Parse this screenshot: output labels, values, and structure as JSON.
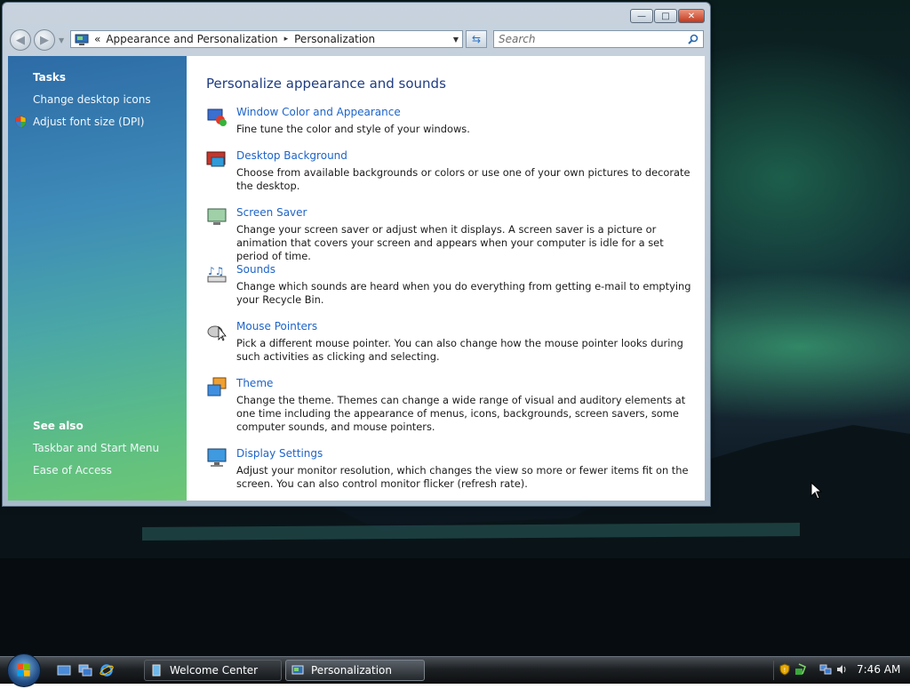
{
  "window": {
    "controls": {
      "minimize": "—",
      "maximize": "□",
      "close": "✕"
    }
  },
  "address_bar": {
    "chevron": "«",
    "breadcrumbs": [
      "Appearance and Personalization",
      "Personalization"
    ],
    "separator": "▸"
  },
  "search": {
    "placeholder": "Search"
  },
  "sidebar": {
    "tasks_heading": "Tasks",
    "tasks": [
      "Change desktop icons",
      "Adjust font size (DPI)"
    ],
    "see_also_heading": "See also",
    "see_also": [
      "Taskbar and Start Menu",
      "Ease of Access"
    ]
  },
  "main": {
    "heading": "Personalize appearance and sounds",
    "items": [
      {
        "title": "Window Color and Appearance",
        "description": "Fine tune the color and style of your windows.",
        "icon": "window-color-icon"
      },
      {
        "title": "Desktop Background",
        "description": "Choose from available backgrounds or colors or use one of your own pictures to decorate the desktop.",
        "icon": "desktop-background-icon"
      },
      {
        "title": "Screen Saver",
        "description": "Change your screen saver or adjust when it displays. A screen saver is a picture or animation that covers your screen and appears when your computer is idle for a set period of time.",
        "icon": "screen-saver-icon"
      },
      {
        "title": "Sounds",
        "description": "Change which sounds are heard when you do everything from getting e-mail to emptying your Recycle Bin.",
        "icon": "sounds-icon"
      },
      {
        "title": "Mouse Pointers",
        "description": "Pick a different mouse pointer. You can also change how the mouse pointer looks during such activities as clicking and selecting.",
        "icon": "mouse-pointers-icon"
      },
      {
        "title": "Theme",
        "description": "Change the theme. Themes can change a wide range of visual and auditory elements at one time including the appearance of menus, icons, backgrounds, screen savers, some computer sounds, and mouse pointers.",
        "icon": "theme-icon"
      },
      {
        "title": "Display Settings",
        "description": "Adjust your monitor resolution, which changes the view so more or fewer items fit on the screen. You can also control monitor flicker (refresh rate).",
        "icon": "display-settings-icon"
      }
    ]
  },
  "taskbar": {
    "buttons": [
      {
        "label": "Welcome Center",
        "active": false
      },
      {
        "label": "Personalization",
        "active": true
      }
    ],
    "clock": "7:46 AM"
  },
  "colors": {
    "link": "#1e64c8",
    "heading": "#1f3c82",
    "sidebar_top": "#2d6ba6",
    "sidebar_bottom": "#6cc675"
  }
}
